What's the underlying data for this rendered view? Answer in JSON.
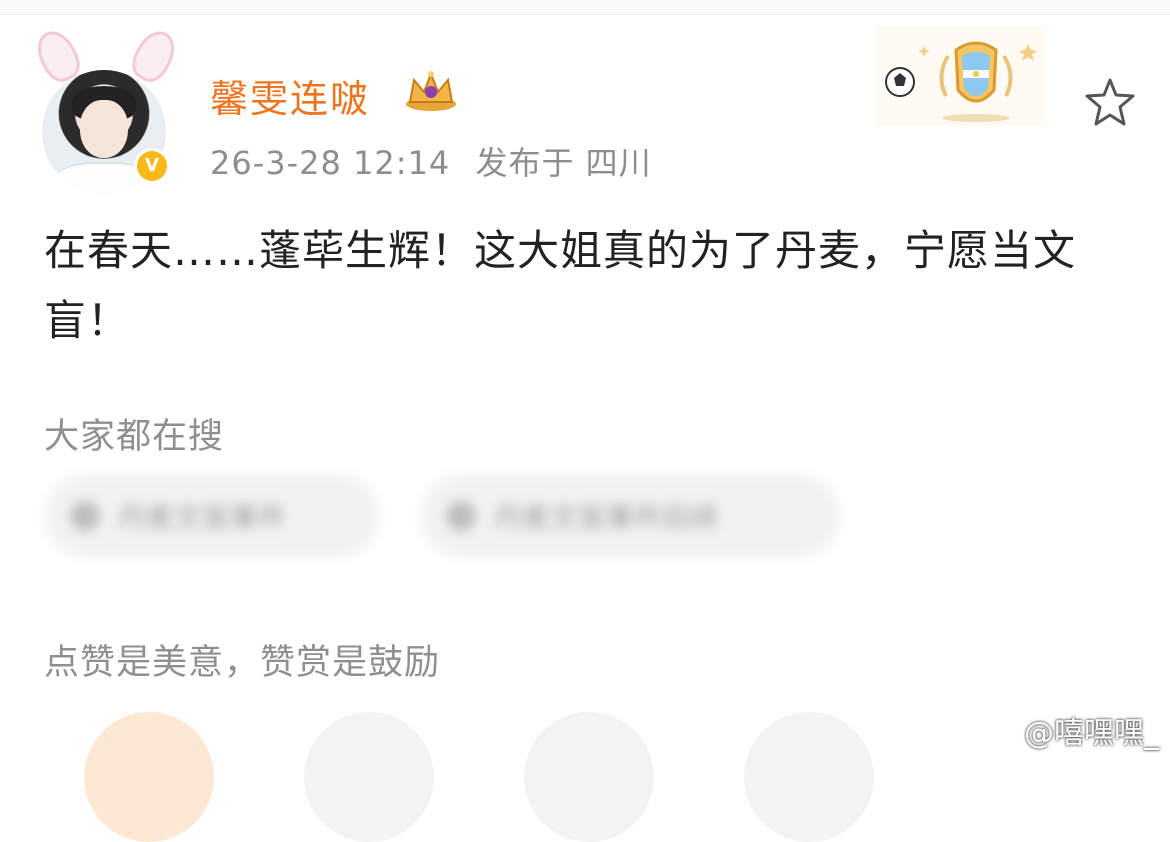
{
  "post": {
    "username": "馨雯连啵",
    "date": "26-3-28 12:14",
    "location": "发布于 四川",
    "text": "在春天……蓬荜生辉！这大姐真的为了丹麦，宁愿当文盲！"
  },
  "sections": {
    "search_title": "大家都在搜",
    "search_chips": [
      {
        "label": "丹麦文盲事件"
      },
      {
        "label": "丹麦文盲事件后续"
      }
    ],
    "reward_title": "点赞是美意，赞赏是鼓励"
  },
  "watermark": {
    "label": "@嘻嘿嘿_"
  },
  "icons": {
    "verified": "verified-v-icon",
    "crown": "crown-icon",
    "badge": "football-argentina-badge",
    "favorite": "star-outline-icon",
    "weibo": "weibo-logo-icon"
  },
  "colors": {
    "username": "#f0731e",
    "meta": "#8e8e8e",
    "verified": "#f8b91b"
  }
}
